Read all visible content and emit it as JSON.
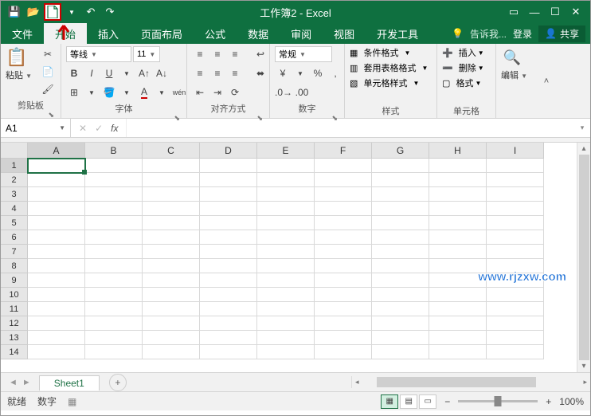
{
  "app": {
    "title": "工作簿2 - Excel"
  },
  "window": {
    "login": "登录",
    "share": "共享"
  },
  "tabs": {
    "file": "文件",
    "items": [
      "开始",
      "插入",
      "页面布局",
      "公式",
      "数据",
      "审阅",
      "视图",
      "开发工具"
    ],
    "tellme": "告诉我..."
  },
  "ribbon": {
    "clipboard": {
      "label": "剪贴板",
      "paste": "粘贴"
    },
    "font": {
      "label": "字体",
      "name": "等线",
      "size": "11"
    },
    "align": {
      "label": "对齐方式"
    },
    "number": {
      "label": "数字",
      "format": "常规"
    },
    "styles": {
      "label": "样式",
      "cond": "条件格式",
      "table": "套用表格格式",
      "cell": "单元格样式"
    },
    "cells": {
      "label": "单元格",
      "insert": "插入",
      "delete": "删除",
      "format": "格式"
    },
    "editing": {
      "label": "编辑"
    }
  },
  "fbar": {
    "name": "A1"
  },
  "grid": {
    "cols": [
      "A",
      "B",
      "C",
      "D",
      "E",
      "F",
      "G",
      "H",
      "I"
    ],
    "rows": [
      1,
      2,
      3,
      4,
      5,
      6,
      7,
      8,
      9,
      10,
      11,
      12,
      13,
      14
    ],
    "activeRow": 1,
    "activeCol": "A"
  },
  "sheettab": {
    "name": "Sheet1"
  },
  "status": {
    "ready": "就绪",
    "numlock": "数字",
    "zoom": "100%"
  },
  "watermark": "www.rjzxw.com"
}
